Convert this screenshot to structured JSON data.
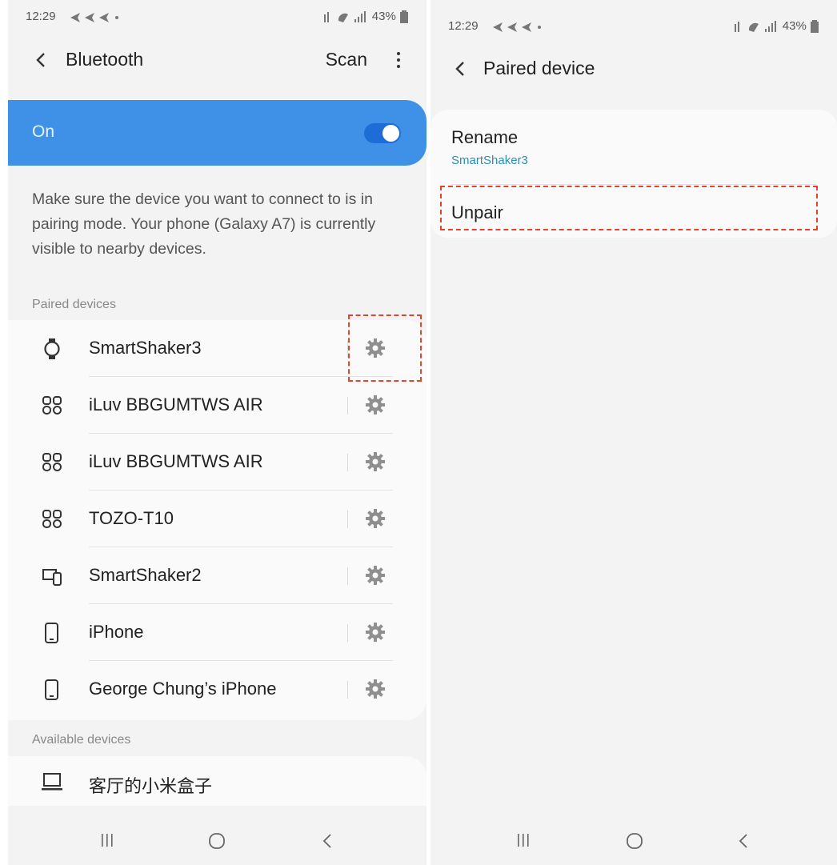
{
  "left": {
    "status": {
      "time": "12:29",
      "battery": "43%"
    },
    "header": {
      "title": "Bluetooth",
      "scan_label": "Scan"
    },
    "toggle": {
      "label": "On",
      "state": true
    },
    "description": "Make sure the device you want to connect to is in pairing mode. Your phone (Galaxy A7) is currently visible to nearby devices.",
    "paired_section": "Paired devices",
    "paired_devices": [
      {
        "name": "SmartShaker3",
        "icon": "watch-icon"
      },
      {
        "name": "iLuv BBGUMTWS AIR",
        "icon": "earbuds-icon"
      },
      {
        "name": "iLuv BBGUMTWS AIR",
        "icon": "earbuds-icon"
      },
      {
        "name": "TOZO-T10",
        "icon": "earbuds-icon"
      },
      {
        "name": "SmartShaker2",
        "icon": "devices-icon"
      },
      {
        "name": "iPhone",
        "icon": "phone-icon"
      },
      {
        "name": "George Chung’s iPhone",
        "icon": "phone-icon"
      }
    ],
    "available_section": "Available devices",
    "available_devices": [
      {
        "name": "客厅的小米盒子",
        "icon": "laptop-icon"
      }
    ]
  },
  "right": {
    "status": {
      "time": "12:29",
      "battery": "43%"
    },
    "header": {
      "title": "Paired device"
    },
    "rename": {
      "label": "Rename",
      "value": "SmartShaker3"
    },
    "unpair": {
      "label": "Unpair"
    }
  },
  "colors": {
    "accent": "#3e91e6",
    "highlight": "#e1442f",
    "link": "#2a8fb0"
  }
}
